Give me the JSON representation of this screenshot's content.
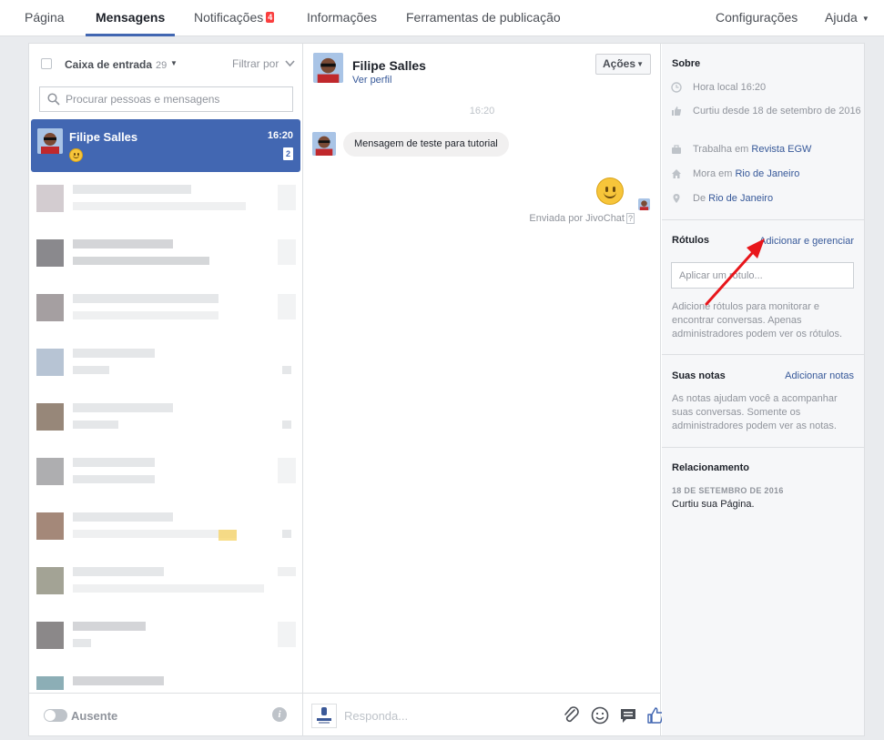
{
  "nav": {
    "items": [
      {
        "label": "Página"
      },
      {
        "label": "Mensagens"
      },
      {
        "label": "Notificações",
        "badge": "4"
      },
      {
        "label": "Informações"
      },
      {
        "label": "Ferramentas de publicação"
      }
    ],
    "settings": "Configurações",
    "help": "Ajuda"
  },
  "inbox": {
    "label": "Caixa de entrada",
    "count": "29",
    "filter": "Filtrar por",
    "search_placeholder": "Procurar pessoas e mensagens",
    "active": {
      "name": "Filipe Salles",
      "time": "16:20",
      "unread": "2"
    },
    "away_label": "Ausente"
  },
  "conversation": {
    "name": "Filipe Salles",
    "profile_link": "Ver perfil",
    "actions": "Ações",
    "time": "16:20",
    "incoming": "Mensagem de teste para tutorial",
    "sent_by": "Enviada por JivoChat",
    "help_mark": "?",
    "reply_placeholder": "Responda..."
  },
  "about": {
    "title": "Sobre",
    "local_time": "Hora local 16:20",
    "liked_since": "Curtiu desde 18 de setembro de 2016",
    "works_prefix": "Trabalha em",
    "works_link": "Revista EGW",
    "lives_prefix": "Mora em",
    "lives_link": "Rio de Janeiro",
    "from_prefix": "De",
    "from_link": "Rio de Janeiro"
  },
  "labels": {
    "title": "Rótulos",
    "manage_link": "Adicionar e gerenciar",
    "input_placeholder": "Aplicar um rótulo...",
    "description": "Adicione rótulos para monitorar e encontrar conversas. Apenas administradores podem ver os rótulos."
  },
  "notes": {
    "title": "Suas notas",
    "add_link": "Adicionar notas",
    "description": "As notas ajudam você a acompanhar suas conversas. Somente os administradores podem ver as notas."
  },
  "relationship": {
    "title": "Relacionamento",
    "date": "18 DE SETEMBRO DE 2016",
    "text": "Curtiu sua Página."
  },
  "colors": {
    "accent": "#4267b2",
    "link": "#365899",
    "badge": "#fa3e3e",
    "arrow": "#e8161b"
  }
}
